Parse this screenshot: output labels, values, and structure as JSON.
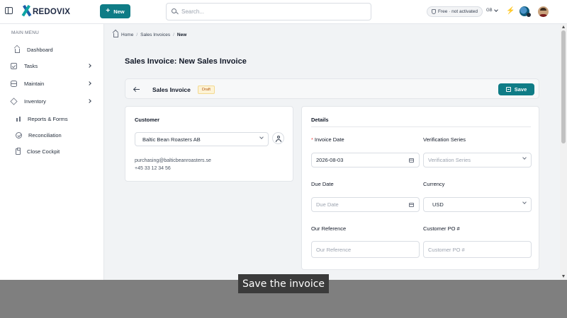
{
  "topbar": {
    "logo_text": "REDOVIX",
    "new_button": "New",
    "search_placeholder": "Search...",
    "plan_badge": "Free · not activated",
    "language": "GB"
  },
  "sidebar": {
    "heading": "MAIN MENU",
    "items": [
      {
        "label": "Dashboard",
        "icon": "home-icon"
      },
      {
        "label": "Tasks",
        "icon": "checkbox-icon",
        "expandable": true
      },
      {
        "label": "Maintain",
        "icon": "database-icon",
        "expandable": true
      },
      {
        "label": "Inventory",
        "icon": "box-icon",
        "expandable": true
      },
      {
        "label": "Reports & Forms",
        "icon": "chart-icon"
      },
      {
        "label": "Reconciliation",
        "icon": "circle-check-icon"
      },
      {
        "label": "Close Cockpit",
        "icon": "clipboard-icon"
      }
    ]
  },
  "breadcrumb": {
    "home": "Home",
    "section": "Sales Invoices",
    "current": "New"
  },
  "page_title": "Sales Invoice: New Sales Invoice",
  "toolbar": {
    "title": "Sales Invoice",
    "status": "Draft",
    "save_label": "Save"
  },
  "customer": {
    "title": "Customer",
    "selected": "Baltic Bean Roasters AB",
    "email": "purchasing@balticbeanroasters.se",
    "phone": "+45 33 12 34 56"
  },
  "details": {
    "title": "Details",
    "invoice_date_label": "Invoice Date",
    "invoice_date_value": "2026-08-03",
    "verification_series_label": "Verification Series",
    "verification_series_placeholder": "Verification Series",
    "due_date_label": "Due Date",
    "due_date_placeholder": "Due Date",
    "currency_label": "Currency",
    "currency_value": "USD",
    "our_reference_label": "Our Reference",
    "our_reference_placeholder": "Our Reference",
    "customer_po_label": "Customer PO #",
    "customer_po_placeholder": "Customer PO #"
  },
  "caption": "Save the invoice",
  "colors": {
    "accent": "#0f7c86",
    "draft_badge_bg": "#fdf3d6",
    "draft_badge_text": "#b45309",
    "required_marker": "#ef4444"
  }
}
